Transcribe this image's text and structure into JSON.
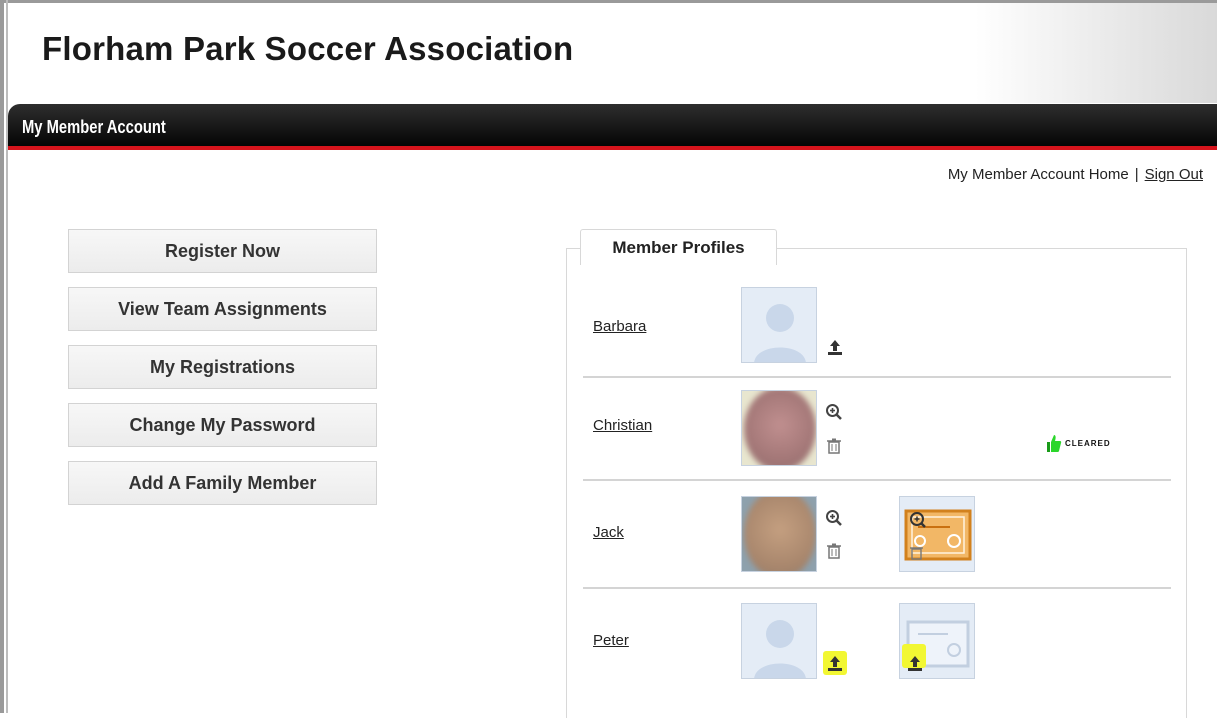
{
  "site": {
    "title": "Florham Park Soccer Association"
  },
  "bar": {
    "title": "My Member Account"
  },
  "topnav": {
    "home_label": "My Member Account Home",
    "separator": "|",
    "signout_label": "Sign Out"
  },
  "menu": {
    "register": "Register Now",
    "team_assignments": "View Team Assignments",
    "registrations": "My Registrations",
    "change_password": "Change My Password",
    "add_family": "Add A Family Member"
  },
  "profiles": {
    "tab_label": "Member Profiles",
    "members": [
      {
        "name": "Barbara"
      },
      {
        "name": "Christian",
        "badge": "CLEARED"
      },
      {
        "name": "Jack"
      },
      {
        "name": "Peter"
      }
    ]
  },
  "colors": {
    "accent_red": "#d6141c",
    "bar_dark": "#111111",
    "highlight": "#f2f733"
  }
}
